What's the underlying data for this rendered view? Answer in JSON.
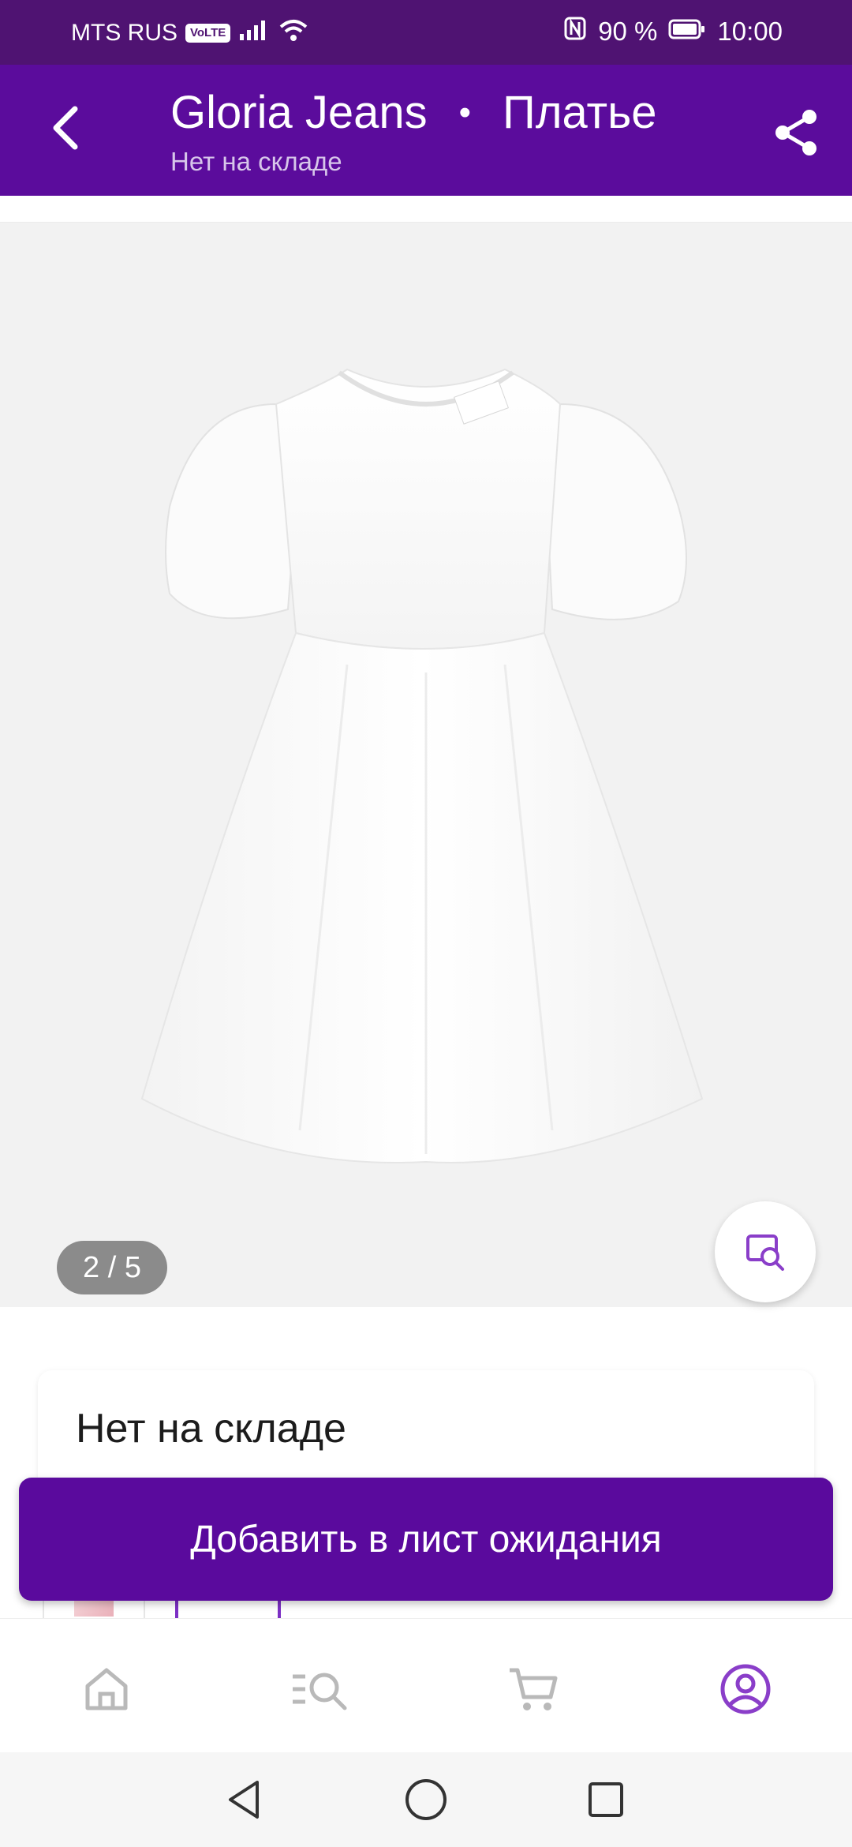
{
  "status_bar": {
    "carrier": "MTS RUS",
    "volte": "VoLTE",
    "battery": "90 %",
    "time": "10:00"
  },
  "app_bar": {
    "brand": "Gloria Jeans",
    "separator": "•",
    "category": "Платье",
    "subtitle": "Нет на складе"
  },
  "gallery": {
    "counter": "2 / 5"
  },
  "stock": {
    "status_text": "Нет на складе"
  },
  "actions": {
    "waitlist_label": "Добавить в лист ожидания"
  },
  "colors": {
    "brand_purple": "#5b0c9c",
    "status_bar": "#4f1372",
    "active_nav": "#8a3ec9",
    "inactive_nav": "#b9b9b9"
  },
  "bottom_nav": {
    "items": [
      "home-icon",
      "catalog-search-icon",
      "cart-icon",
      "profile-icon"
    ],
    "active": "profile-icon"
  }
}
